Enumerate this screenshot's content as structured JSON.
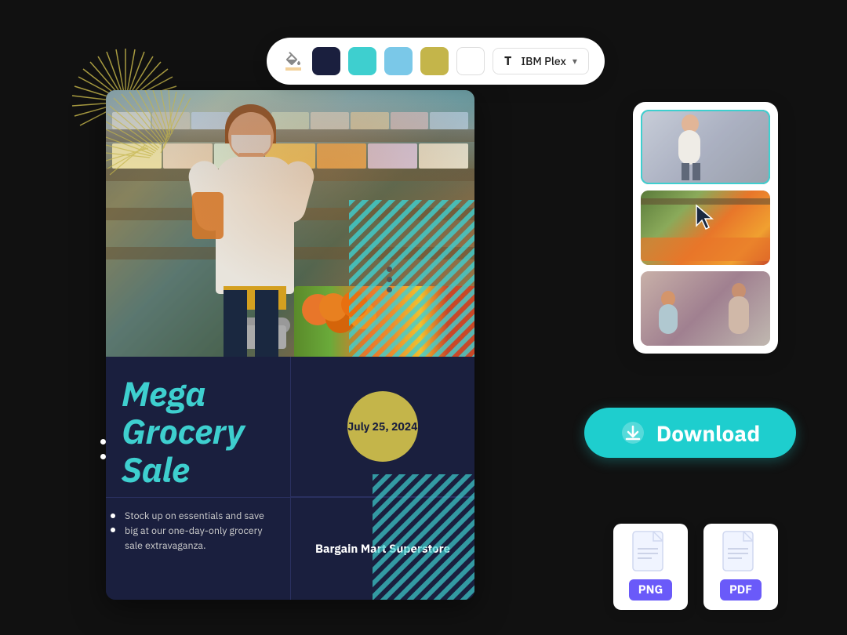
{
  "toolbar": {
    "colors": [
      {
        "name": "dark-navy",
        "hex": "#1a1f3e"
      },
      {
        "name": "teal",
        "hex": "#3ecfcf"
      },
      {
        "name": "light-blue",
        "hex": "#7ac8e8"
      },
      {
        "name": "khaki",
        "hex": "#c4b54a"
      },
      {
        "name": "white",
        "hex": "#ffffff"
      }
    ],
    "font_selector_label": "IBM Plex",
    "font_t_icon": "T"
  },
  "poster": {
    "title": "Mega Grocery Sale",
    "date": "July 25, 2024",
    "description": "Stock up on essentials and save big at our one-day-only grocery sale extravaganza.",
    "store_name": "Bargain Mart Superstore"
  },
  "image_panel": {
    "thumb_count": 3
  },
  "download_btn": {
    "label": "Download"
  },
  "file_formats": [
    {
      "label": "PNG"
    },
    {
      "label": "PDF"
    }
  ]
}
